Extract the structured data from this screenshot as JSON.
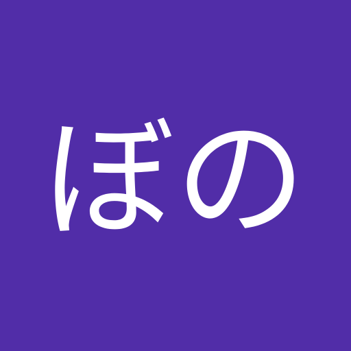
{
  "avatar": {
    "initials": "ぼの",
    "background_color": "#512da8",
    "text_color": "#ffffff"
  }
}
